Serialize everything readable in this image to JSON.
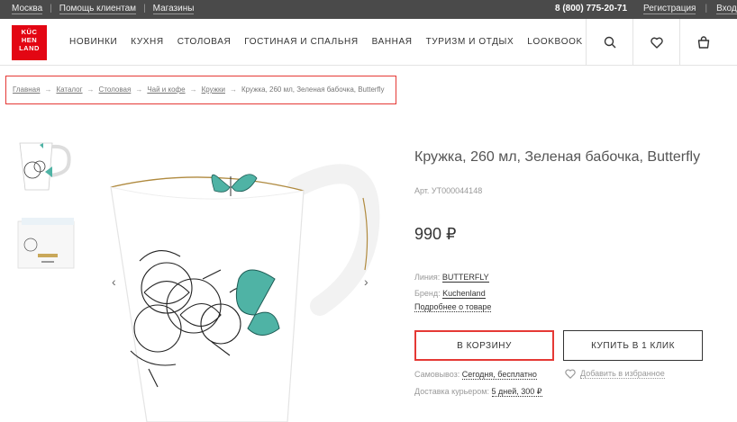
{
  "topbar": {
    "city": "Москва",
    "help": "Помощь клиентам",
    "shops": "Магазины",
    "phone": "8 (800) 775-20-71",
    "register": "Регистрация",
    "login": "Вход"
  },
  "logo": {
    "line1": "KÜC",
    "line2": "HEN",
    "line3": "LAND"
  },
  "nav": [
    "НОВИНКИ",
    "КУХНЯ",
    "СТОЛОВАЯ",
    "ГОСТИНАЯ И СПАЛЬНЯ",
    "ВАННАЯ",
    "ТУРИЗМ И ОТДЫХ",
    "LOOKBOOK"
  ],
  "breadcrumbs": [
    "Главная",
    "Каталог",
    "Столовая",
    "Чай и кофе",
    "Кружки"
  ],
  "breadcrumb_current": "Кружка, 260 мл, Зеленая бабочка, Butterfly",
  "breadcrumb_arrow": "→",
  "product": {
    "title": "Кружка, 260 мл, Зеленая бабочка, Butterfly",
    "sku": "Арт. УТ000044148",
    "price": "990 ₽",
    "line_label": "Линия:",
    "line_value": "BUTTERFLY",
    "brand_label": "Бренд:",
    "brand_value": "Kuchenland",
    "more": "Подробнее о товаре",
    "cart_button": "В КОРЗИНУ",
    "buy_button": "КУПИТЬ В 1 КЛИК",
    "pickup_label": "Самовывоз:",
    "pickup_value": "Сегодня, бесплатно",
    "delivery_label": "Доставка курьером:",
    "delivery_value": "5 дней,  300 ₽",
    "favorite": "Добавить в избранное"
  },
  "gallery": {
    "prev": "‹",
    "next": "›"
  },
  "colors": {
    "accent": "#e53935",
    "topbar": "#4a4a4a",
    "butterfly": "#4fb3a5"
  },
  "icons": [
    "search-icon",
    "heart-icon",
    "bag-icon"
  ]
}
